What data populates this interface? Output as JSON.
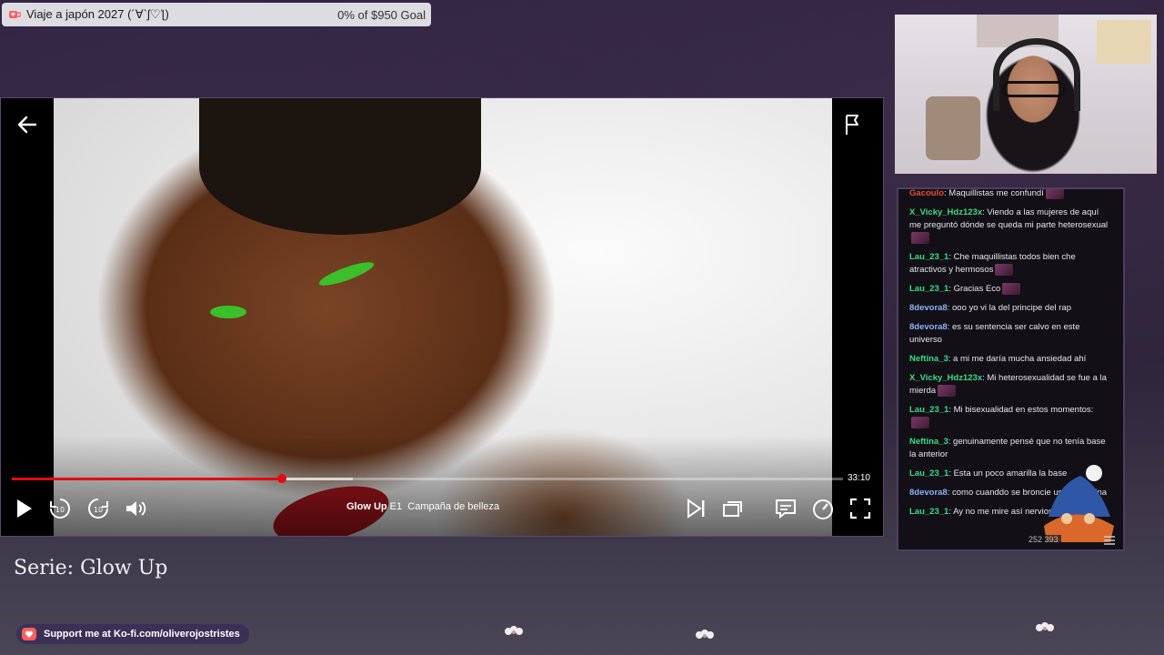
{
  "goal": {
    "title": "Viaje a japón 2027 (´∀`ʃ♡ƪ)",
    "progress_text": "0% of $950 Goal",
    "progress": 0
  },
  "player": {
    "time_remaining": "33:10",
    "progress_fraction": 0.325,
    "buffer_fraction": 0.41,
    "show_name": "Glow Up",
    "episode": "E1",
    "episode_title": "Campaña de belleza"
  },
  "overlay": {
    "series_label": "Serie: Glow Up",
    "kofi_text": "Support me at Ko-fi.com/oliverojostristes"
  },
  "chat": {
    "viewer_count": "252 393",
    "colors": {
      "green": "#3ddc84",
      "blue": "#8ab4f8",
      "teal": "#2ec4b6",
      "cut": "#e74c3c"
    },
    "messages": [
      {
        "user": "Gacoulo",
        "text": "Maquillistas me confundí",
        "color": "cut",
        "emote": true
      },
      {
        "user": "X_Vicky_Hdz123x",
        "text": "Viendo a las mujeres de aquí me preguntó dónde se queda mi parte heterosexual",
        "color": "green",
        "emote": true
      },
      {
        "user": "Lau_23_1",
        "text": "Che maquillistas todos bien che atractivos y hermosos",
        "color": "green",
        "emote": true
      },
      {
        "user": "Lau_23_1",
        "text": "Gracias Eco",
        "color": "green",
        "emote": true
      },
      {
        "user": "8devora8",
        "text": "ooo yo vi la del principe del rap",
        "color": "blue",
        "emote": false
      },
      {
        "user": "8devora8",
        "text": "es su sentencia ser calvo en este universo",
        "color": "blue",
        "emote": false
      },
      {
        "user": "Neftina_3",
        "text": "a mi me daría mucha ansiedad ahí",
        "color": "green",
        "emote": false
      },
      {
        "user": "X_Vicky_Hdz123x",
        "text": "Mi heterosexualidad se fue a la mierda",
        "color": "green",
        "emote": true
      },
      {
        "user": "Lau_23_1",
        "text": "Mi bisexualidad en estos momentos:",
        "color": "green",
        "emote": true
      },
      {
        "user": "Neftina_3",
        "text": "genuinamente pensé que no tenía base la anterior",
        "color": "green",
        "emote": false
      },
      {
        "user": "Lau_23_1",
        "text": "Esta un poco amarilla la base",
        "color": "green",
        "emote": false
      },
      {
        "user": "8devora8",
        "text": "como cuanddo se broncie usaba chalina",
        "color": "blue",
        "emote": false
      },
      {
        "user": "Lau_23_1",
        "text": "Ay no me mire así nerviosa",
        "color": "green",
        "emote": true
      }
    ]
  }
}
